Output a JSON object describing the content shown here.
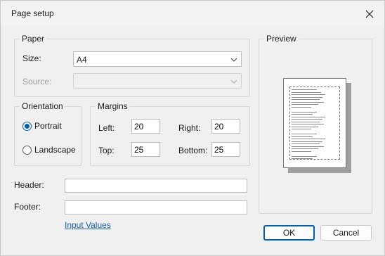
{
  "dialog": {
    "title": "Page setup"
  },
  "paper": {
    "legend": "Paper",
    "size_label": "Size:",
    "size_value": "A4",
    "source_label": "Source:",
    "source_value": ""
  },
  "orientation": {
    "legend": "Orientation",
    "options": [
      {
        "label": "Portrait",
        "checked": true
      },
      {
        "label": "Landscape",
        "checked": false
      }
    ]
  },
  "margins": {
    "legend": "Margins",
    "left_label": "Left:",
    "left_value": "20",
    "right_label": "Right:",
    "right_value": "20",
    "top_label": "Top:",
    "top_value": "25",
    "bottom_label": "Bottom:",
    "bottom_value": "25"
  },
  "preview": {
    "legend": "Preview"
  },
  "header": {
    "label": "Header:",
    "value": ""
  },
  "footer": {
    "label": "Footer:",
    "value": ""
  },
  "input_values_link": "Input Values",
  "buttons": {
    "ok": "OK",
    "cancel": "Cancel"
  },
  "colors": {
    "accent": "#005fb8",
    "link": "#1a5bb5",
    "window_bg": "#f0f0f0"
  }
}
